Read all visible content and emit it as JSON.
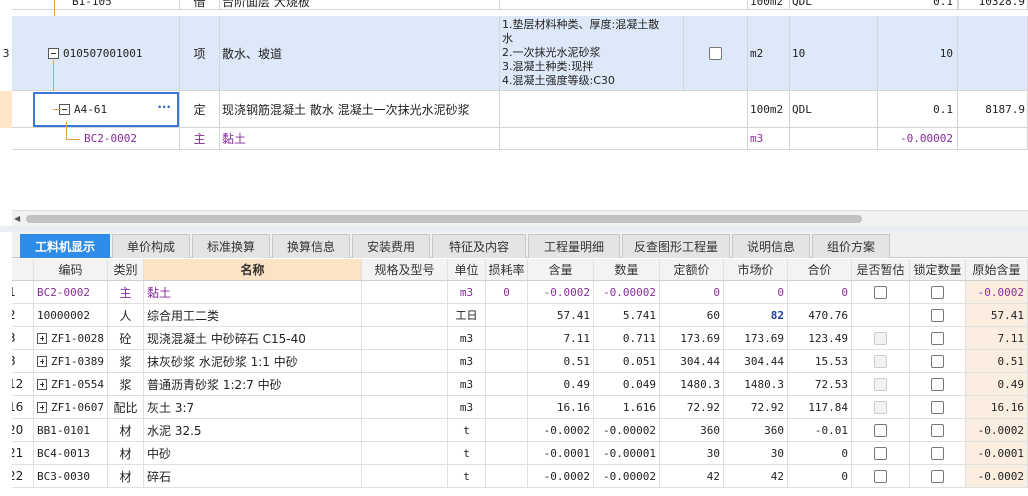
{
  "upper_rows": [
    {
      "num": "",
      "code": "B1-105",
      "unit_type": "借",
      "name": "台阶面层 大烧板",
      "desc": "",
      "unit": "100m2",
      "qty_expr": "QDL",
      "qty": "0.1",
      "price": "10328.9"
    },
    {
      "num": "3",
      "code": "010507001001",
      "unit_type": "项",
      "name": "散水、坡道",
      "desc": "1.垫层材料种类、厚度:混凝土散水\n2.一次抹光水泥砂浆\n3.混凝土种类:现拌\n4.混凝土强度等级:C30",
      "unit": "m2",
      "qty_expr": "10",
      "qty": "10",
      "price": ""
    },
    {
      "num": "",
      "code": "A4-61",
      "unit_type": "定",
      "name": "现浇钢筋混凝土 散水 混凝土一次抹光水泥砂浆",
      "desc": "",
      "unit": "100m2",
      "qty_expr": "QDL",
      "qty": "0.1",
      "price": "8187.9",
      "more": "···"
    },
    {
      "num": "",
      "code": "BC2-0002",
      "unit_type": "主",
      "name": "黏土",
      "desc": "",
      "unit": "m3",
      "qty_expr": "",
      "qty": "-0.00002",
      "price": ""
    }
  ],
  "tabs": [
    "工料机显示",
    "单价构成",
    "标准换算",
    "换算信息",
    "安装费用",
    "特征及内容",
    "工程量明细",
    "反查图形工程量",
    "说明信息",
    "组价方案"
  ],
  "lower_headers": [
    "编码",
    "类别",
    "名称",
    "规格及型号",
    "单位",
    "损耗率",
    "含量",
    "数量",
    "定额价",
    "市场价",
    "合价",
    "是否暂估",
    "锁定数量",
    "原始含量"
  ],
  "lower_rows": [
    {
      "num": "1",
      "code": "BC2-0002",
      "cat": "主",
      "name": "黏土",
      "spec": "",
      "unit": "m3",
      "loss": "0",
      "content": "-0.0002",
      "qty": "-0.00002",
      "quota": "0",
      "market": "0",
      "total": "0",
      "orig": "-0.0002",
      "purple": true,
      "expand": false,
      "est": "box",
      "lock": "box"
    },
    {
      "num": "2",
      "code": "10000002",
      "cat": "人",
      "name": "综合用工二类",
      "spec": "",
      "unit": "工日",
      "loss": "",
      "content": "57.41",
      "qty": "5.741",
      "quota": "60",
      "market": "82",
      "total": "470.76",
      "orig": "57.41",
      "purple": false,
      "expand": false,
      "est": "",
      "lock": "box",
      "market_bold": true
    },
    {
      "num": "3",
      "code": "ZF1-0028",
      "cat": "砼",
      "name": "现浇混凝土 中砂碎石 C15-40",
      "spec": "",
      "unit": "m3",
      "loss": "",
      "content": "7.11",
      "qty": "0.711",
      "quota": "173.69",
      "market": "173.69",
      "total": "123.49",
      "orig": "7.11",
      "purple": false,
      "expand": true,
      "est": "dis",
      "lock": "box"
    },
    {
      "num": "8",
      "code": "ZF1-0389",
      "cat": "浆",
      "name": "抹灰砂浆 水泥砂浆 1:1 中砂",
      "spec": "",
      "unit": "m3",
      "loss": "",
      "content": "0.51",
      "qty": "0.051",
      "quota": "304.44",
      "market": "304.44",
      "total": "15.53",
      "orig": "0.51",
      "purple": false,
      "expand": true,
      "est": "dis",
      "lock": "box"
    },
    {
      "num": "12",
      "code": "ZF1-0554",
      "cat": "浆",
      "name": "普通沥青砂浆 1:2:7 中砂",
      "spec": "",
      "unit": "m3",
      "loss": "",
      "content": "0.49",
      "qty": "0.049",
      "quota": "1480.3",
      "market": "1480.3",
      "total": "72.53",
      "orig": "0.49",
      "purple": false,
      "expand": true,
      "est": "dis",
      "lock": "box"
    },
    {
      "num": "16",
      "code": "ZF1-0607",
      "cat": "配比",
      "name": "灰土 3:7",
      "spec": "",
      "unit": "m3",
      "loss": "",
      "content": "16.16",
      "qty": "1.616",
      "quota": "72.92",
      "market": "72.92",
      "total": "117.84",
      "orig": "16.16",
      "purple": false,
      "expand": true,
      "est": "dis",
      "lock": "box"
    },
    {
      "num": "20",
      "code": "BB1-0101",
      "cat": "材",
      "name": "水泥 32.5",
      "spec": "",
      "unit": "t",
      "loss": "",
      "content": "-0.0002",
      "qty": "-0.00002",
      "quota": "360",
      "market": "360",
      "total": "-0.01",
      "orig": "-0.0002",
      "purple": false,
      "expand": false,
      "est": "box",
      "lock": "box"
    },
    {
      "num": "21",
      "code": "BC4-0013",
      "cat": "材",
      "name": "中砂",
      "spec": "",
      "unit": "t",
      "loss": "",
      "content": "-0.0001",
      "qty": "-0.00001",
      "quota": "30",
      "market": "30",
      "total": "0",
      "orig": "-0.0001",
      "purple": false,
      "expand": false,
      "est": "box",
      "lock": "box"
    },
    {
      "num": "22",
      "code": "BC3-0030",
      "cat": "材",
      "name": "碎石",
      "spec": "",
      "unit": "t",
      "loss": "",
      "content": "-0.0002",
      "qty": "-0.00002",
      "quota": "42",
      "market": "42",
      "total": "0",
      "orig": "-0.0002",
      "purple": false,
      "expand": false,
      "est": "box",
      "lock": "box"
    }
  ],
  "colors": {
    "tab_active": "#2d8ce8",
    "selected_row": "#dde8f8",
    "child_code": "#8a2c9e",
    "tree_line": "#e2a24a",
    "name_header": "#fbe3c5"
  }
}
